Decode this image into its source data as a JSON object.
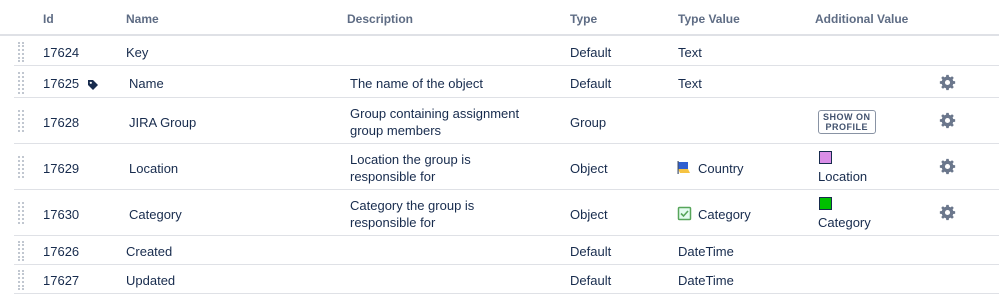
{
  "columns": {
    "id": "Id",
    "name": "Name",
    "description": "Description",
    "type": "Type",
    "type_value": "Type Value",
    "additional_value": "Additional Value"
  },
  "rows": [
    {
      "id": "17624",
      "name": "Key",
      "description": "",
      "type": "Default",
      "type_value": "Text"
    },
    {
      "id": "17625",
      "name": "Name",
      "description": "The name of the object",
      "type": "Default",
      "type_value": "Text",
      "label_icon": "tag-icon"
    },
    {
      "id": "17628",
      "name": "JIRA Group",
      "description_line1": "Group containing assignment",
      "description_line2": "group members",
      "type": "Group",
      "type_value": "",
      "additional_badge_line1": "SHOW ON",
      "additional_badge_line2": "PROFILE"
    },
    {
      "id": "17629",
      "name": "Location",
      "description_line1": "Location the group is",
      "description_line2": "responsible for",
      "type": "Object",
      "type_value": "Country",
      "type_value_icon": "flag-icon",
      "additional_label": "Location",
      "additional_color": "#da8ee7"
    },
    {
      "id": "17630",
      "name": "Category",
      "description_line1": "Category the group is",
      "description_line2": "responsible for",
      "type": "Object",
      "type_value": "Category",
      "type_value_icon": "checkbox-icon",
      "additional_label": "Category",
      "additional_color": "#00c000"
    },
    {
      "id": "17626",
      "name": "Created",
      "description": "",
      "type": "Default",
      "type_value": "DateTime"
    },
    {
      "id": "17627",
      "name": "Updated",
      "description": "",
      "type": "Default",
      "type_value": "DateTime"
    }
  ]
}
